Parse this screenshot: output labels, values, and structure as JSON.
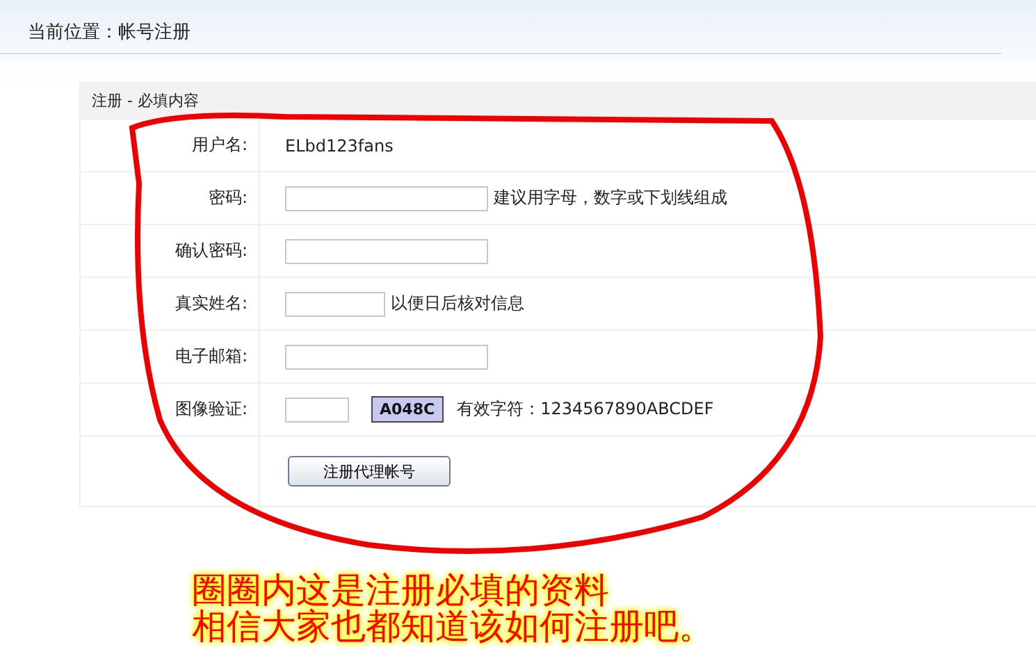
{
  "breadcrumb": "当前位置：帐号注册",
  "panel": {
    "title": "注册 - 必填内容",
    "rows": [
      {
        "label": "用户名:",
        "kind": "text",
        "value": "ELbd123fans"
      },
      {
        "label": "密码:",
        "kind": "input",
        "hint": "建议用字母，数字或下划线组成"
      },
      {
        "label": "确认密码:",
        "kind": "input"
      },
      {
        "label": "真实姓名:",
        "kind": "input-short",
        "hint": "以便日后核对信息"
      },
      {
        "label": "电子邮箱:",
        "kind": "input"
      },
      {
        "label": "图像验证:",
        "kind": "captcha",
        "code": "A048C",
        "hint": "有效字符：1234567890ABCDEF"
      }
    ],
    "submit": "注册代理帐号"
  },
  "annotation": [
    "圈圈内这是注册必填的资料",
    "相信大家也都知道该如何注册吧。"
  ]
}
